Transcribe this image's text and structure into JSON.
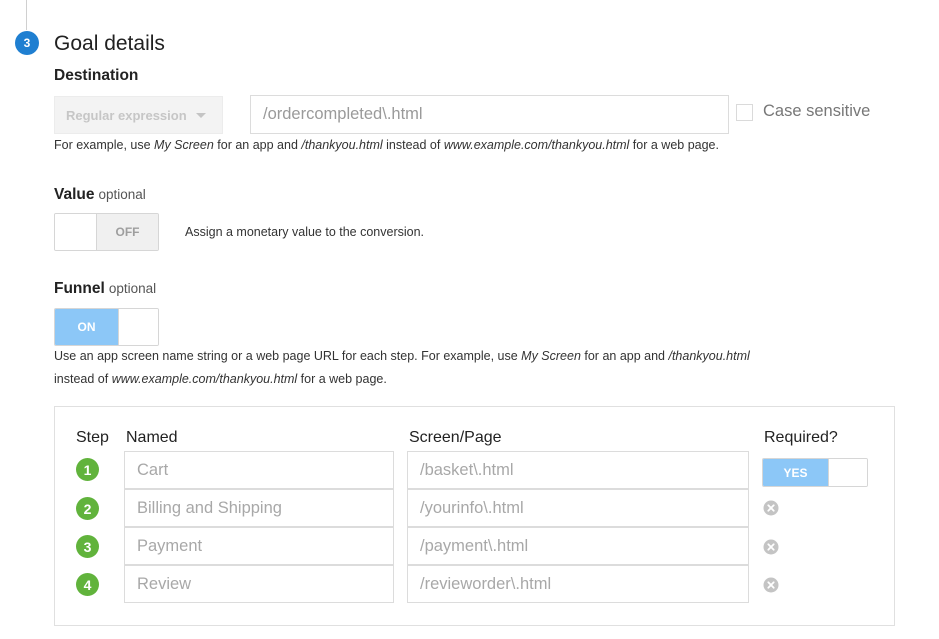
{
  "section": {
    "step_number": "3",
    "title": "Goal details"
  },
  "destination": {
    "label": "Destination",
    "match_type": "Regular expression",
    "value": "/ordercompleted\\.html",
    "case_sensitive_label": "Case sensitive",
    "case_sensitive_checked": false,
    "help": {
      "p1": "For example, use ",
      "e1": "My Screen",
      "p2": " for an app and ",
      "e2": "/thankyou.html",
      "p3": " instead of ",
      "e3": "www.example.com/thankyou.html",
      "p4": " for a web page."
    }
  },
  "value": {
    "label": "Value",
    "optional": "optional",
    "toggle_label": "OFF",
    "help": "Assign a monetary value to the conversion."
  },
  "funnel": {
    "label": "Funnel",
    "optional": "optional",
    "toggle_label": "ON",
    "help": {
      "p1": "Use an app screen name string or a web page URL for each step. For example, use ",
      "e1": "My Screen",
      "p2": " for an app and ",
      "e2": "/thankyou.html",
      "p3": "instead of ",
      "e3": "www.example.com/thankyou.html",
      "p4": " for a web page."
    },
    "headers": {
      "step": "Step",
      "named": "Named",
      "screen": "Screen/Page",
      "required": "Required?"
    },
    "required_toggle_label": "YES",
    "steps": [
      {
        "num": "1",
        "name": "Cart",
        "screen": "/basket\\.html"
      },
      {
        "num": "2",
        "name": "Billing and Shipping",
        "screen": "/yourinfo\\.html"
      },
      {
        "num": "3",
        "name": "Payment",
        "screen": "/payment\\.html"
      },
      {
        "num": "4",
        "name": "Review",
        "screen": "/revieworder\\.html"
      }
    ]
  },
  "colors": {
    "accent_blue": "#1f7fd1",
    "toggle_on": "#8cc7f7",
    "step_green": "#61b33c"
  }
}
